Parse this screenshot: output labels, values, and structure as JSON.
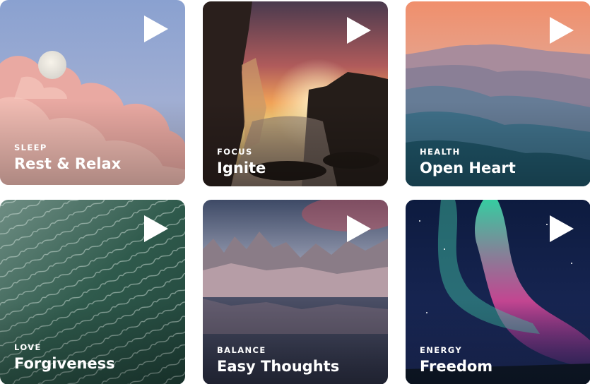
{
  "cards": [
    {
      "category": "SLEEP",
      "title": "Rest & Relax",
      "icon": "play-icon"
    },
    {
      "category": "FOCUS",
      "title": "Ignite",
      "icon": "play-icon"
    },
    {
      "category": "HEALTH",
      "title": "Open Heart",
      "icon": "play-icon"
    },
    {
      "category": "LOVE",
      "title": "Forgiveness",
      "icon": "play-icon"
    },
    {
      "category": "BALANCE",
      "title": "Easy Thoughts",
      "icon": "play-icon"
    },
    {
      "category": "ENERGY",
      "title": "Freedom",
      "icon": "play-icon"
    }
  ],
  "colors": {
    "text": "#ffffff",
    "sleep_sky": "#8fa5cf",
    "sleep_cloud": "#e8a9a3",
    "focus_sun": "#f3a35a",
    "health_mountain": "#2f6f80",
    "love_ocean": "#2f5a4c",
    "balance_mountain": "#a89aa8",
    "energy_aurora": "#3fd3a3"
  }
}
